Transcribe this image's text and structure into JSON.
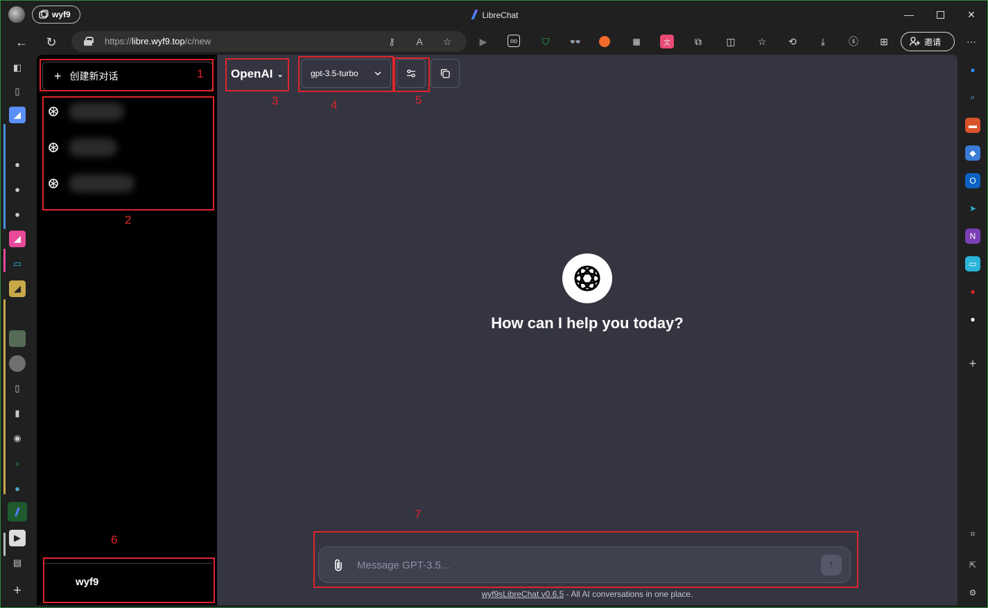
{
  "browser": {
    "profile_name": "wyf9",
    "window_title": "LibreChat",
    "url_prefix": "https://",
    "url_host": "libre.wyf9.top",
    "url_path": "/c/new",
    "invite_label": "邀请"
  },
  "sidebar": {
    "new_chat_label": "创建新对话",
    "conversations": [
      {
        "icon": "openai-icon"
      },
      {
        "icon": "openai-icon"
      },
      {
        "icon": "openai-icon"
      }
    ],
    "user_name": "wyf9"
  },
  "header": {
    "endpoint": "OpenAI",
    "model": "gpt-3.5-turbo"
  },
  "main": {
    "greeting": "How can I help you today?",
    "input_placeholder": "Message GPT-3.5...",
    "footer_link": "wyf9sLibreChat v0.6.5",
    "footer_text": " - All AI conversations in one place."
  },
  "annotations": {
    "n1": "1",
    "n2": "2",
    "n3": "3",
    "n4": "4",
    "n5": "5",
    "n6": "6",
    "n7": "7"
  },
  "colors": {
    "annotation_red": "#e0242b",
    "app_bg": "#343541",
    "sidebar_bg": "#000000",
    "window_border": "#2e8b3a"
  }
}
